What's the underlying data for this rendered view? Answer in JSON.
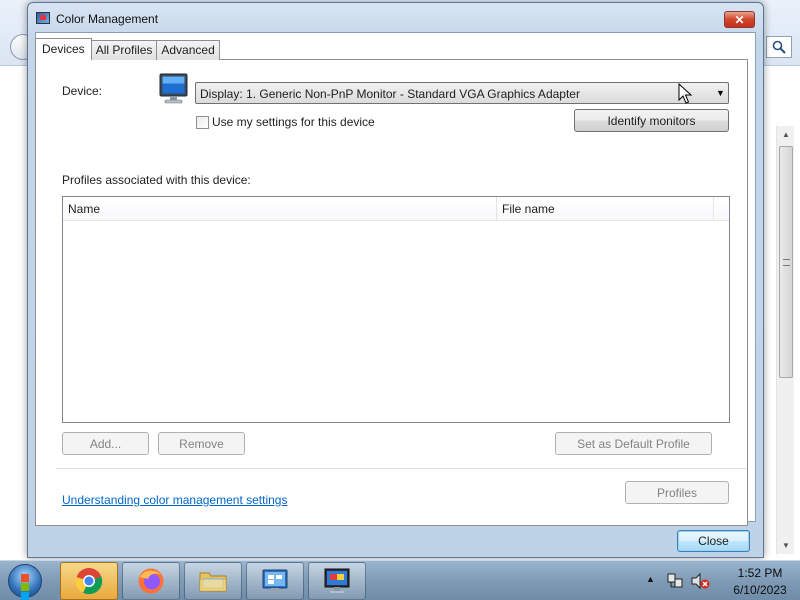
{
  "window": {
    "title": "Color Management",
    "close_glyph": "✕"
  },
  "tabs": [
    {
      "label": "Devices",
      "active": true
    },
    {
      "label": "All Profiles",
      "active": false
    },
    {
      "label": "Advanced",
      "active": false
    }
  ],
  "devices_tab": {
    "device_label": "Device:",
    "device_value": "Display: 1. Generic Non-PnP Monitor - Standard VGA Graphics Adapter",
    "use_my_settings_label": "Use my settings for this device",
    "use_my_settings_checked": false,
    "identify_monitors_label": "Identify monitors",
    "profiles_label": "Profiles associated with this device:",
    "profiles_table": {
      "columns": [
        "Name",
        "File name"
      ],
      "rows": []
    },
    "add_label": "Add...",
    "remove_label": "Remove",
    "set_default_label": "Set as Default Profile",
    "profiles_button_label": "Profiles",
    "help_link": "Understanding color management settings"
  },
  "close_button_label": "Close",
  "taskbar": {
    "items": [
      {
        "name": "chrome",
        "icon": "chrome-icon"
      },
      {
        "name": "firefox",
        "icon": "firefox-icon"
      },
      {
        "name": "file-explorer",
        "icon": "folder-icon"
      },
      {
        "name": "control-panel",
        "icon": "control-panel-icon"
      },
      {
        "name": "color-management",
        "icon": "monitor-icon",
        "active": true
      }
    ],
    "clock_time": "1:52 PM",
    "clock_date": "6/10/2023"
  },
  "colors": {
    "link": "#0066cc",
    "taskbar": "#7f9bb6",
    "close_button": "#c2311b"
  }
}
